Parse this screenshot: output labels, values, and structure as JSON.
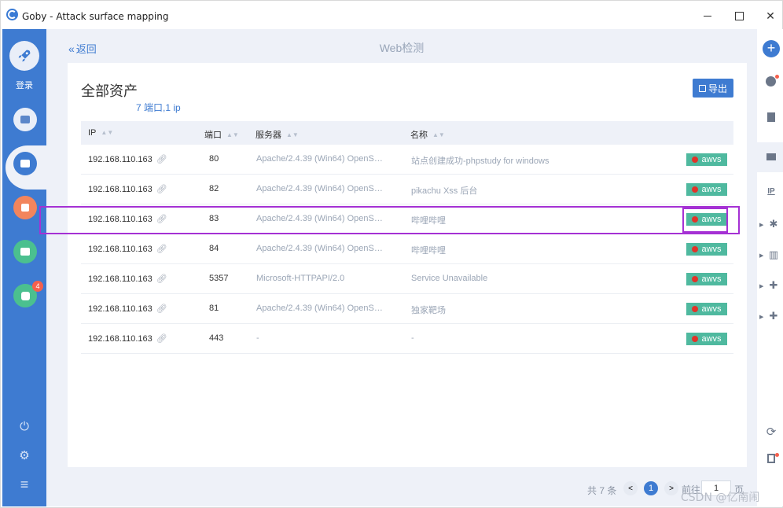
{
  "window": {
    "title": "Goby - Attack surface mapping",
    "minimize": "–",
    "maximize": "□",
    "close": "✕"
  },
  "sidebar": {
    "login_label": "登录",
    "items": [
      {
        "name": "scan",
        "color": "#e9eef8",
        "icon": "window-icon"
      },
      {
        "name": "assets",
        "color": "#3e7bd1",
        "icon": "list-icon",
        "active": true
      },
      {
        "name": "vulns",
        "color": "#f2855d",
        "icon": "bug-icon"
      },
      {
        "name": "stats",
        "color": "#4bc08f",
        "icon": "chart-icon"
      },
      {
        "name": "plugins",
        "color": "#4bc08f",
        "icon": "puzzle-icon",
        "badge": "4"
      }
    ],
    "bottom": [
      {
        "name": "power",
        "icon": "power-icon",
        "glyph": "⏻"
      },
      {
        "name": "settings",
        "icon": "gear-icon",
        "glyph": "⚙"
      },
      {
        "name": "menu",
        "icon": "menu-icon",
        "glyph": "≡"
      }
    ]
  },
  "header": {
    "back_label": "返回",
    "back_glyph": "«",
    "page_title": "Web检测"
  },
  "card": {
    "title": "全部资产",
    "summary": "7 端口,1 ip",
    "export_label": "导出"
  },
  "table": {
    "columns": [
      "IP",
      "端口",
      "服务器",
      "名称"
    ],
    "rows": [
      {
        "ip": "192.168.110.163",
        "port": "80",
        "server": "Apache/2.4.39 (Win64) OpenSS...",
        "name": "站点创建成功-phpstudy for windows",
        "tag": "awvs"
      },
      {
        "ip": "192.168.110.163",
        "port": "82",
        "server": "Apache/2.4.39 (Win64) OpenSS...",
        "name": "pikachu Xss 后台",
        "tag": "awvs"
      },
      {
        "ip": "192.168.110.163",
        "port": "83",
        "server": "Apache/2.4.39 (Win64) OpenSS...",
        "name": "哔哩哔哩",
        "tag": "awvs",
        "highlighted": true
      },
      {
        "ip": "192.168.110.163",
        "port": "84",
        "server": "Apache/2.4.39 (Win64) OpenSS...",
        "name": "哔哩哔哩",
        "tag": "awvs"
      },
      {
        "ip": "192.168.110.163",
        "port": "5357",
        "server": "Microsoft-HTTPAPI/2.0",
        "name": "Service Unavailable",
        "tag": "awvs"
      },
      {
        "ip": "192.168.110.163",
        "port": "81",
        "server": "Apache/2.4.39 (Win64) OpenSS...",
        "name": "独家靶场",
        "tag": "awvs"
      },
      {
        "ip": "192.168.110.163",
        "port": "443",
        "server": "-",
        "name": "-",
        "tag": "awvs"
      }
    ],
    "colors": {
      "tag_bg": "#4fb99f",
      "highlight": "#a531d4"
    }
  },
  "pagination": {
    "total": "共 7 条",
    "current": "1",
    "goto_label": "前往",
    "goto_value": "1",
    "page_suffix": "页"
  },
  "rightbar": {
    "add": "+",
    "icons": [
      "history-icon",
      "document-icon",
      "monitor-icon",
      "ip-icon",
      "bug-icon",
      "bar-chart-icon",
      "puzzle-icon",
      "puzzle-settings-icon"
    ],
    "ip_label": "IP",
    "bottom_icons": [
      "refresh-icon",
      "report-icon"
    ]
  },
  "watermark": "CSDN @亿南闹"
}
